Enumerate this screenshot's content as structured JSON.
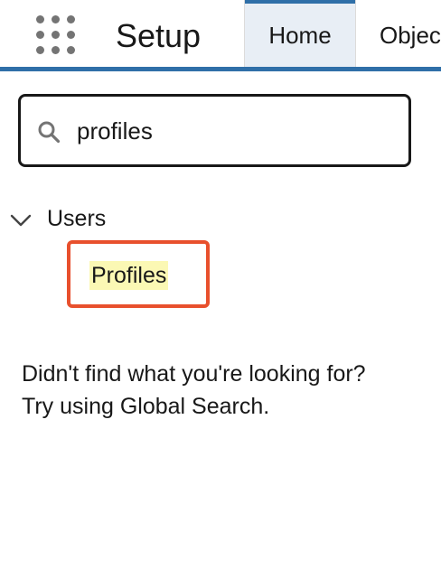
{
  "header": {
    "app_title": "Setup",
    "app_launcher_icon": "waffle-grid-icon",
    "tabs": [
      {
        "label": "Home",
        "active": true
      },
      {
        "label": "Object Manager",
        "active": false
      }
    ],
    "accent_color": "#2f6fa8"
  },
  "sidebar": {
    "search": {
      "value": "profiles",
      "icon": "search-icon"
    },
    "tree": [
      {
        "label": "Users",
        "expanded": true,
        "toggle_icon": "chevron-down-icon",
        "children": [
          {
            "label": "Profiles",
            "highlighted": true
          }
        ]
      }
    ],
    "highlight_box_color": "#e8502d",
    "match_highlight_color": "#fbf8b4",
    "not_found": {
      "line1": "Didn't find what you're looking for?",
      "line2": "Try using Global Search."
    }
  }
}
